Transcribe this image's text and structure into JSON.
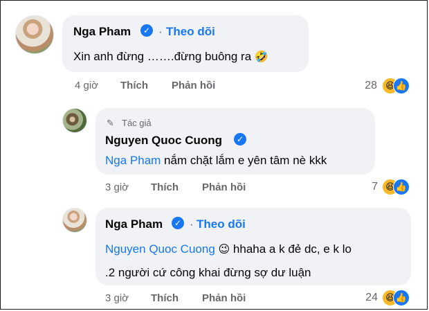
{
  "comments": [
    {
      "author": "Nga Pham",
      "follow_label": "Theo dõi",
      "separator": "·",
      "text": "Xin anh đừng …….đừng buông ra",
      "emoji": "🤣",
      "time": "4 giờ",
      "like_label": "Thích",
      "reply_label": "Phản hồi",
      "reaction_count": "28"
    },
    {
      "author_badge": "Tác giả",
      "author": "Nguyen Quoc Cuong",
      "mention": "Nga Pham",
      "text": " nắm chặt lắm e yên tâm nè kkk",
      "time": "3 giờ",
      "like_label": "Thích",
      "reply_label": "Phản hồi",
      "reaction_count": "7"
    },
    {
      "author": "Nga Pham",
      "follow_label": "Theo dõi",
      "separator": "·",
      "mention": "Nguyen Quoc Cuong",
      "emoji": "😉",
      "text_line1": " hhaha a k đẻ dc, e k lo",
      "text_line2": ".2 người cứ công khai đừng sợ dư luận",
      "time": "3 giờ",
      "like_label": "Thích",
      "reply_label": "Phản hồi",
      "reaction_count": "24"
    }
  ],
  "icons": {
    "verified": "verified-badge-icon",
    "pencil": "pencil-icon",
    "haha": "haha-reaction-icon",
    "like": "like-reaction-icon"
  },
  "colors": {
    "link_blue": "#1877f2",
    "bubble_bg": "#f0f2f5",
    "meta_gray": "#65676b",
    "haha_yellow": "#f7b928"
  }
}
